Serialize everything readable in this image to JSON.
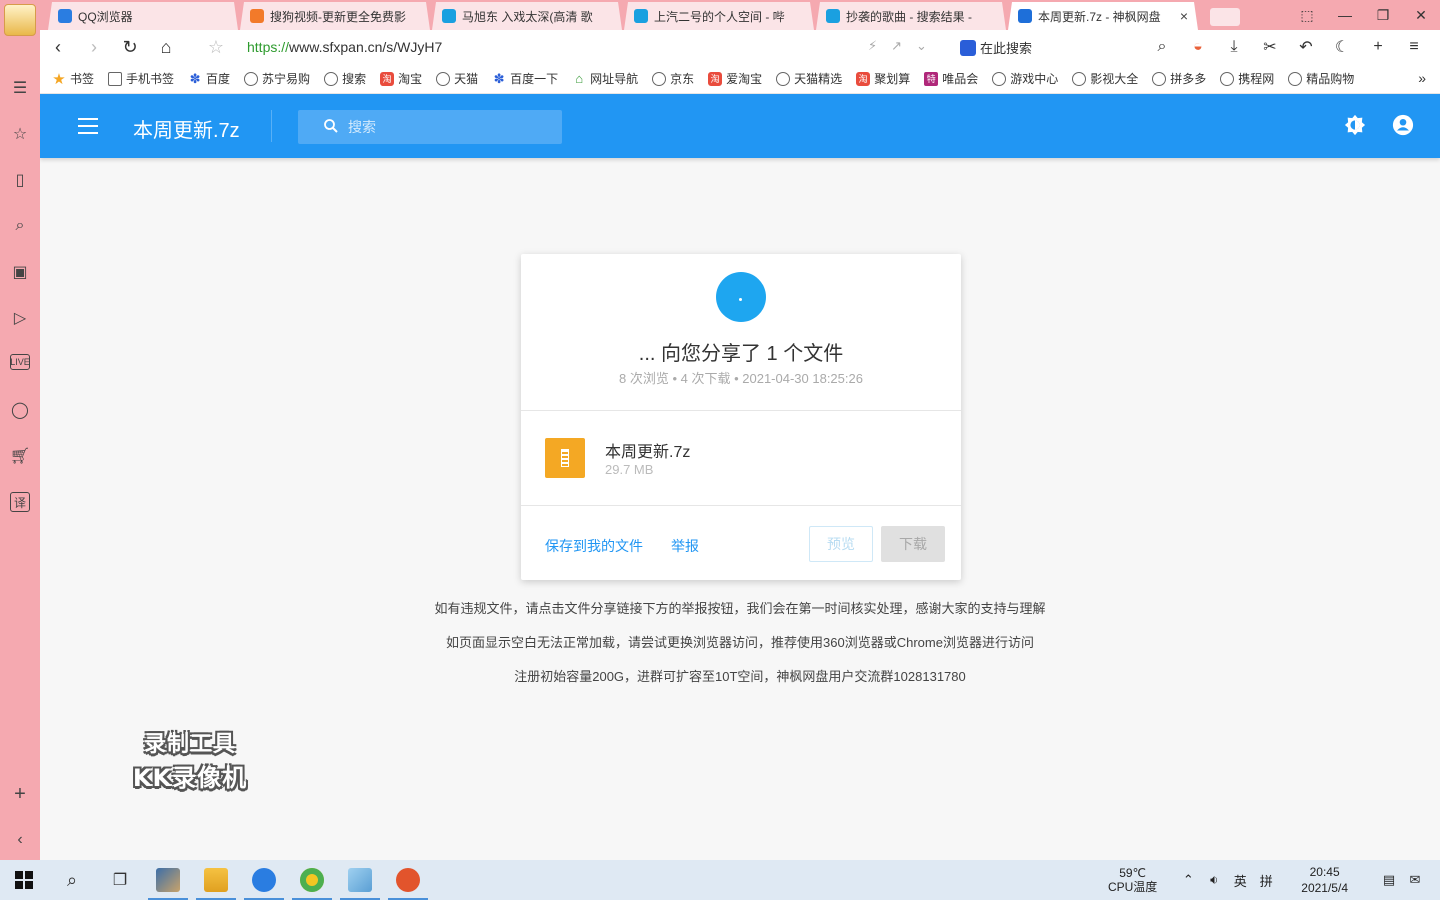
{
  "browser": {
    "tabs": [
      {
        "title": "QQ浏览器",
        "icon": "qq-browser-icon",
        "color": "#2a7de1",
        "active": false
      },
      {
        "title": "搜狗视频-更新更全免费影",
        "icon": "sogou-icon",
        "color": "#f27a2a",
        "active": false
      },
      {
        "title": "马旭东 入戏太深(高清 歌",
        "icon": "bilibili-icon",
        "color": "#1aa0e0",
        "active": false
      },
      {
        "title": "上汽二号的个人空间 - 哔",
        "icon": "bilibili-icon",
        "color": "#1aa0e0",
        "active": false
      },
      {
        "title": "抄袭的歌曲 - 搜索结果 - ",
        "icon": "bilibili-icon",
        "color": "#1aa0e0",
        "active": false
      },
      {
        "title": "本周更新.7z - 神枫网盘",
        "icon": "sfxpan-icon",
        "color": "#1e6fd9",
        "active": true,
        "close": "×"
      }
    ],
    "url_scheme": "https://",
    "url_rest": "www.sfxpan.cn/s/WJyH7",
    "search_engine_label": "在此搜索",
    "bookmarks": [
      {
        "label": "书签",
        "icon": "star-icon",
        "style": "star",
        "glyph": "★"
      },
      {
        "label": "手机书签",
        "icon": "mobile-icon",
        "style": "sq",
        "glyph": ""
      },
      {
        "label": "百度",
        "icon": "baidu-icon",
        "style": "blue",
        "glyph": "✽"
      },
      {
        "label": "苏宁易购",
        "icon": "globe-icon",
        "style": "globe",
        "glyph": ""
      },
      {
        "label": "搜索",
        "icon": "globe-icon",
        "style": "globe",
        "glyph": ""
      },
      {
        "label": "淘宝",
        "icon": "taobao-icon",
        "style": "red",
        "glyph": "淘"
      },
      {
        "label": "天猫",
        "icon": "globe-icon",
        "style": "globe",
        "glyph": ""
      },
      {
        "label": "百度一下",
        "icon": "baidu-icon",
        "style": "blue",
        "glyph": "✽"
      },
      {
        "label": "网址导航",
        "icon": "home-nav-icon",
        "style": "green",
        "glyph": "⌂"
      },
      {
        "label": "京东",
        "icon": "globe-icon",
        "style": "globe",
        "glyph": ""
      },
      {
        "label": "爱淘宝",
        "icon": "taobao-icon",
        "style": "red",
        "glyph": "淘"
      },
      {
        "label": "天猫精选",
        "icon": "globe-icon",
        "style": "globe",
        "glyph": ""
      },
      {
        "label": "聚划算",
        "icon": "taobao-icon",
        "style": "red",
        "glyph": "淘"
      },
      {
        "label": "唯品会",
        "icon": "vip-icon",
        "style": "purple",
        "glyph": "特"
      },
      {
        "label": "游戏中心",
        "icon": "globe-icon",
        "style": "globe",
        "glyph": ""
      },
      {
        "label": "影视大全",
        "icon": "globe-icon",
        "style": "globe",
        "glyph": ""
      },
      {
        "label": "拼多多",
        "icon": "globe-icon",
        "style": "globe",
        "glyph": ""
      },
      {
        "label": "携程网",
        "icon": "globe-icon",
        "style": "globe",
        "glyph": ""
      },
      {
        "label": "精品购物",
        "icon": "globe-icon",
        "style": "globe",
        "glyph": ""
      }
    ]
  },
  "app": {
    "title": "本周更新.7z",
    "search_placeholder": "搜索",
    "accent": "#2196f3"
  },
  "share": {
    "title": "... 向您分享了 1 个文件",
    "meta": "8 次浏览 • 4 次下载 • 2021-04-30 18:25:26",
    "file_name": "本周更新.7z",
    "file_size": "29.7 MB",
    "save_label": "保存到我的文件",
    "report_label": "举报",
    "preview_label": "预览",
    "download_label": "下载"
  },
  "notices": [
    "如有违规文件，请点击文件分享链接下方的举报按钮，我们会在第一时间核实处理，感谢大家的支持与理解",
    "如页面显示空白无法正常加载，请尝试更换浏览器访问，推荐使用360浏览器或Chrome浏览器进行访问",
    "注册初始容量200G，进群可扩容至10T空间，神枫网盘用户交流群1028131780"
  ],
  "watermark": {
    "line1": "录制工具",
    "line2": "KK录像机"
  },
  "taskbar": {
    "temperature": "59℃",
    "temperature_label": "CPU温度",
    "ime_lang": "英",
    "ime_mode": "拼",
    "time": "20:45",
    "date": "2021/5/4"
  }
}
